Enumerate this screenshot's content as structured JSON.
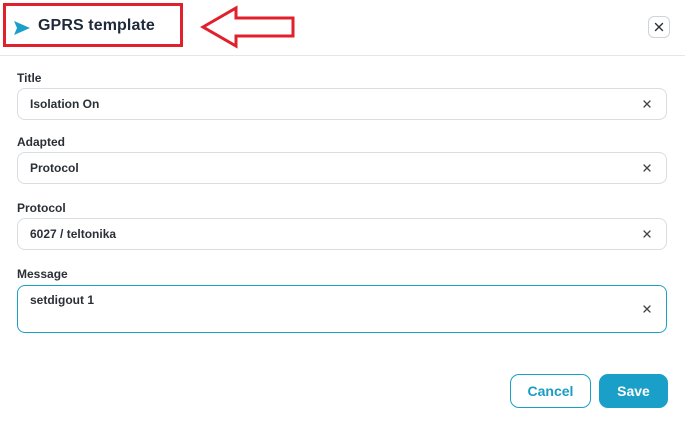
{
  "dialog": {
    "title": "GPRS template",
    "title_icon": "send-icon",
    "close_icon": "close-icon"
  },
  "fields": [
    {
      "label": "Title",
      "value": "Isolation On"
    },
    {
      "label": "Adapted",
      "value": "Protocol"
    },
    {
      "label": "Protocol",
      "value": "6027 / teltonika"
    },
    {
      "label": "Message",
      "value": "setdigout 1"
    }
  ],
  "footer": {
    "cancel_label": "Cancel",
    "save_label": "Save"
  },
  "colors": {
    "accent": "#1aa0c8",
    "annotation": "#e0202a",
    "field_border": "#d9dde2"
  }
}
